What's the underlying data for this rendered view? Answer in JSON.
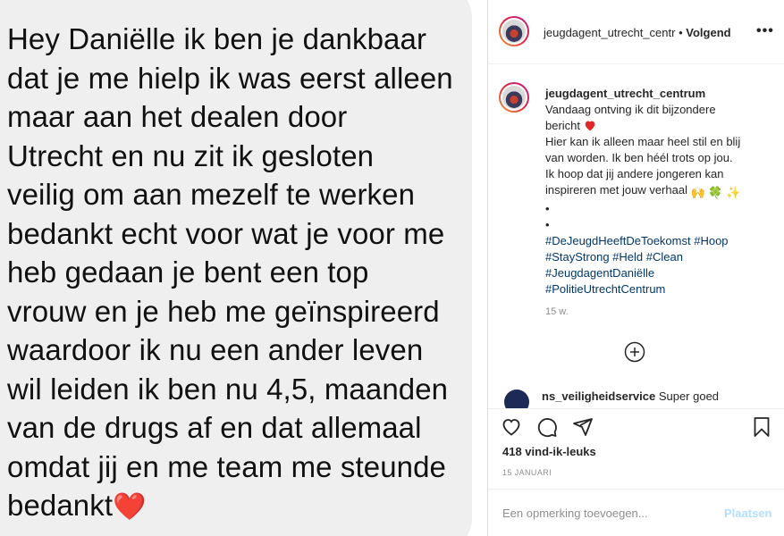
{
  "post_image": {
    "message_text": "Hey Daniëlle ik ben je dankbaar\ndat je me hielp ik was eerst alleen\nmaar aan het dealen door\nUtrecht en nu zit ik gesloten\nveilig om aan mezelf te werken\nbedankt echt voor wat je voor me\nheb gedaan je bent een top\nvrouw en je heb me geïnspireerd\nwaardoor ik nu een ander leven\nwil leiden ik ben nu 4,5, maanden\nvan de drugs af en dat allemaal\nomdat jij en me team me steunde\nbedankt",
    "heart": "❤️"
  },
  "header": {
    "username": "jeugdagent_utrecht_centr",
    "separator": "•",
    "follow_label": "Volgend",
    "more_label": "•••"
  },
  "caption": {
    "username": "jeugdagent_utrecht_centrum",
    "line1": "Vandaag ontving ik dit bijzondere",
    "line2": "bericht",
    "line3": "Hier kan ik alleen maar heel stil en blij",
    "line4": "van worden. Ik ben héél trots op jou.",
    "line5": "Ik hoop dat jij andere jongeren kan",
    "line6": "inspireren met jouw verhaal",
    "emojis": "🙌 🍀 ✨",
    "dot1": "•",
    "dot2": "•",
    "tag1": "#DeJeugdHeeftDeToekomst",
    "tag2": "#Hoop",
    "tag3": "#StayStrong",
    "tag4": "#Held",
    "tag5": "#Clean",
    "tag6": "#JeugdagentDaniëlle",
    "tag7": "#PolitieUtrechtCentrum",
    "age": "15 w."
  },
  "next_comment": {
    "username": "ns_veiligheidservice",
    "text": "Super goed"
  },
  "actions": {
    "likes": "418 vind-ik-leuks",
    "date": "15 JANUARI"
  },
  "add_comment": {
    "placeholder": "Een opmerking toevoegen...",
    "post_label": "Plaatsen"
  },
  "colors": {
    "hashtag": "#00376b",
    "post_disabled": "#b2dffc",
    "heart": "#ed4956"
  }
}
